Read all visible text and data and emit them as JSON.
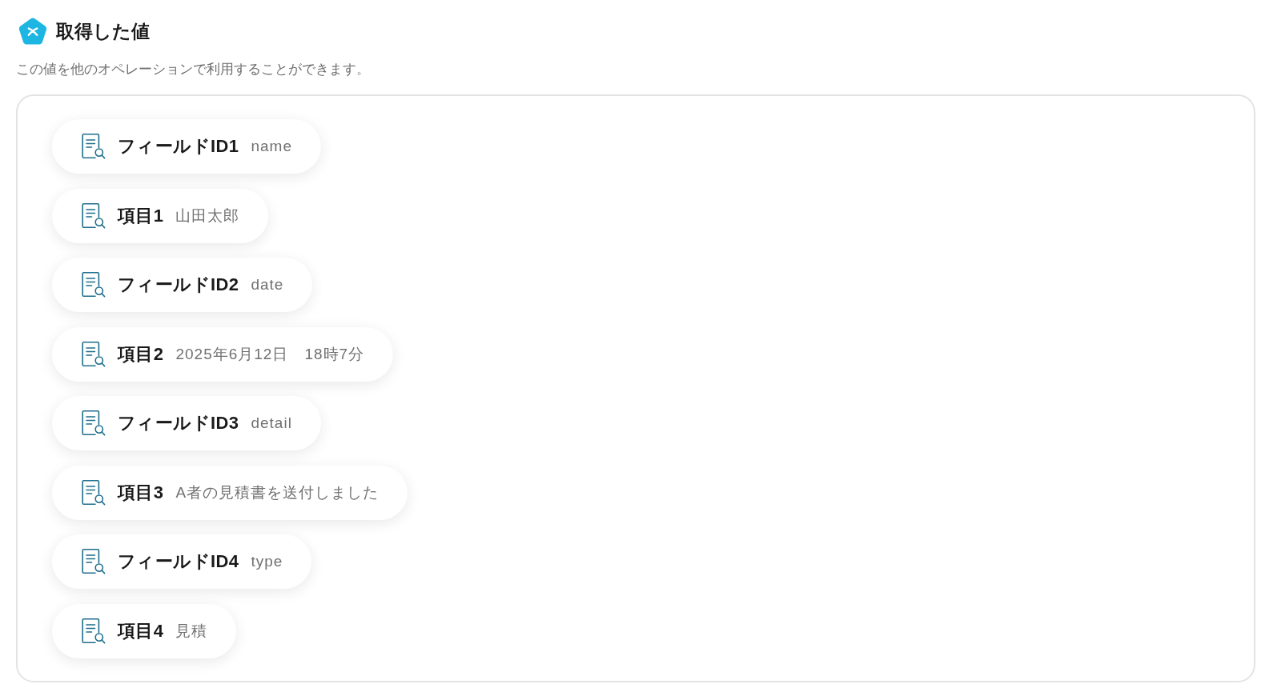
{
  "header": {
    "title": "取得した値",
    "description": "この値を他のオペレーションで利用することができます。"
  },
  "fields": [
    {
      "label": "フィールドID1",
      "value": "name"
    },
    {
      "label": "項目1",
      "value": "山田太郎"
    },
    {
      "label": "フィールドID2",
      "value": "date"
    },
    {
      "label": "項目2",
      "value": "2025年6月12日　18時7分"
    },
    {
      "label": "フィールドID3",
      "value": "detail"
    },
    {
      "label": "項目3",
      "value": "A者の見積書を送付しました"
    },
    {
      "label": "フィールドID4",
      "value": "type"
    },
    {
      "label": "項目4",
      "value": "見積"
    }
  ]
}
